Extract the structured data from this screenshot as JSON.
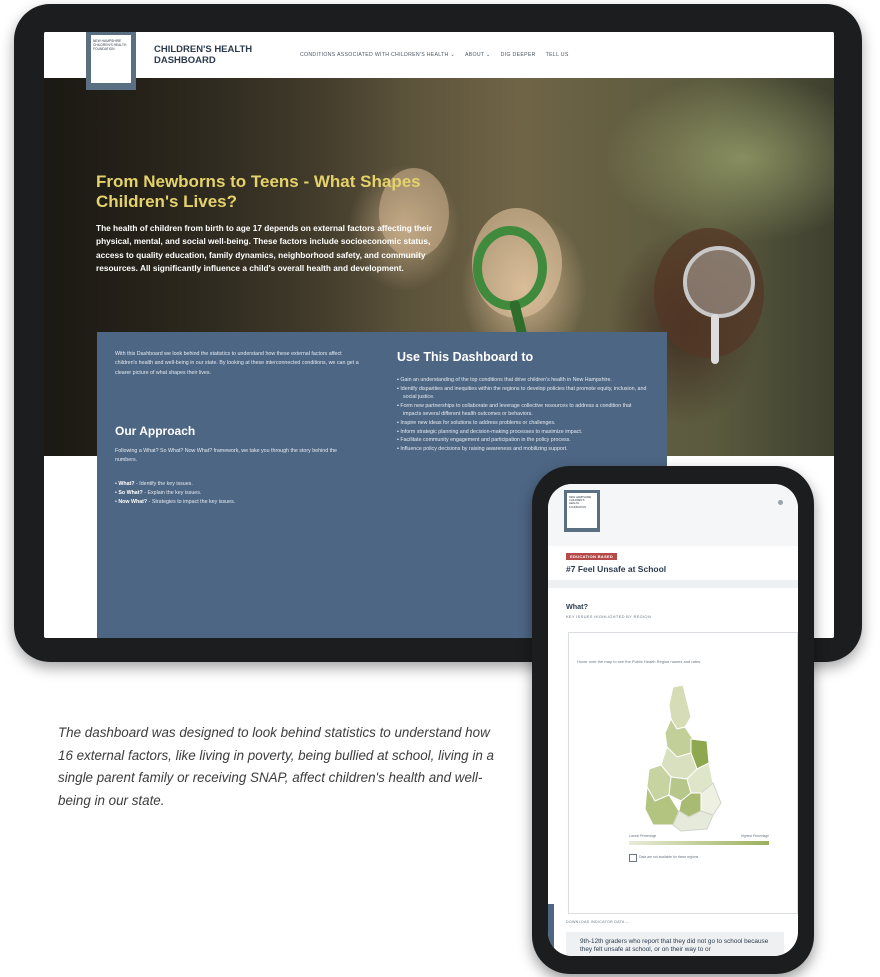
{
  "site": {
    "logo_text": "NEW HAMPSHIRE CHILDREN'S HEALTH FOUNDATION",
    "brand_line1": "CHILDREN'S HEALTH",
    "brand_line2": "DASHBOARD",
    "nav": [
      "CONDITIONS ASSOCIATED WITH CHILDREN'S HEALTH ⌄",
      "ABOUT ⌄",
      "DIG DEEPER",
      "TELL US"
    ]
  },
  "hero": {
    "title": "From Newborns to Teens - What Shapes Children's Lives?",
    "text": "The health of children from birth to age 17 depends on external factors affecting their physical, mental, and social well-being. These factors include socioeconomic status, access to quality education, family dynamics, neighborhood safety, and community resources. All significantly influence a child's overall health and development."
  },
  "panel": {
    "intro": "With this Dashboard we look behind the statistics to understand how these external factors affect children's health and well-being in our state. By looking at these interconnected conditions, we can get a clearer picture of what shapes their lives.",
    "approach_title": "Our Approach",
    "approach_text": "Following a What? So What? Now What? framework, we take you through the story behind the numbers.",
    "approach_items": [
      {
        "term": "What?",
        "desc": " - Identify the key issues."
      },
      {
        "term": "So What?",
        "desc": " - Explain the key issues."
      },
      {
        "term": "Now What?",
        "desc": " - Strategies to impact the key issues."
      }
    ],
    "use_title": "Use This Dashboard to",
    "use_items": [
      "Gain an understanding of the top conditions that drive children's health in New Hampshire.",
      "Identify disparities and inequities within the regions to develop policies that promote equity, inclusion, and social justice.",
      "Form new partnerships to collaborate and leverage collective resources to address a condition that impacts several different health outcomes or behaviors.",
      "Inspire new ideas for solutions to address problems or challenges.",
      "Inform strategic planning and decision-making processes to maximize impact.",
      "Facilitate community engagement and participation in the policy process.",
      "Influence policy decisions by raising awareness and mobilizing support."
    ]
  },
  "phone": {
    "logo_text": "NEW HAMPSHIRE CHILDREN'S HEALTH FOUNDATION",
    "badge": "EDUCATION BASED",
    "heading": "#7 Feel Unsafe at School",
    "what": "What?",
    "what_sub": "KEY ISSUES HIGHLIGHTED BY REGION",
    "hover_hint": "Hover over the map to see the Public Health Region names and rates.",
    "legend_low": "Lowest Percentage",
    "legend_high": "Highest Percentage",
    "checkbox_label": "Data are not available for these regions",
    "data_link": "DOWNLOAD INDICATOR DATA ⌄",
    "bottom_text": "9th-12th graders who report that they did not go to school because they felt unsafe at school, or on their way to or"
  },
  "caption": "The dashboard was designed to look behind statistics to understand how 16 external factors, like living in poverty, being bullied at school, living in a single parent family or receiving SNAP, affect children's health and well-being in our state."
}
